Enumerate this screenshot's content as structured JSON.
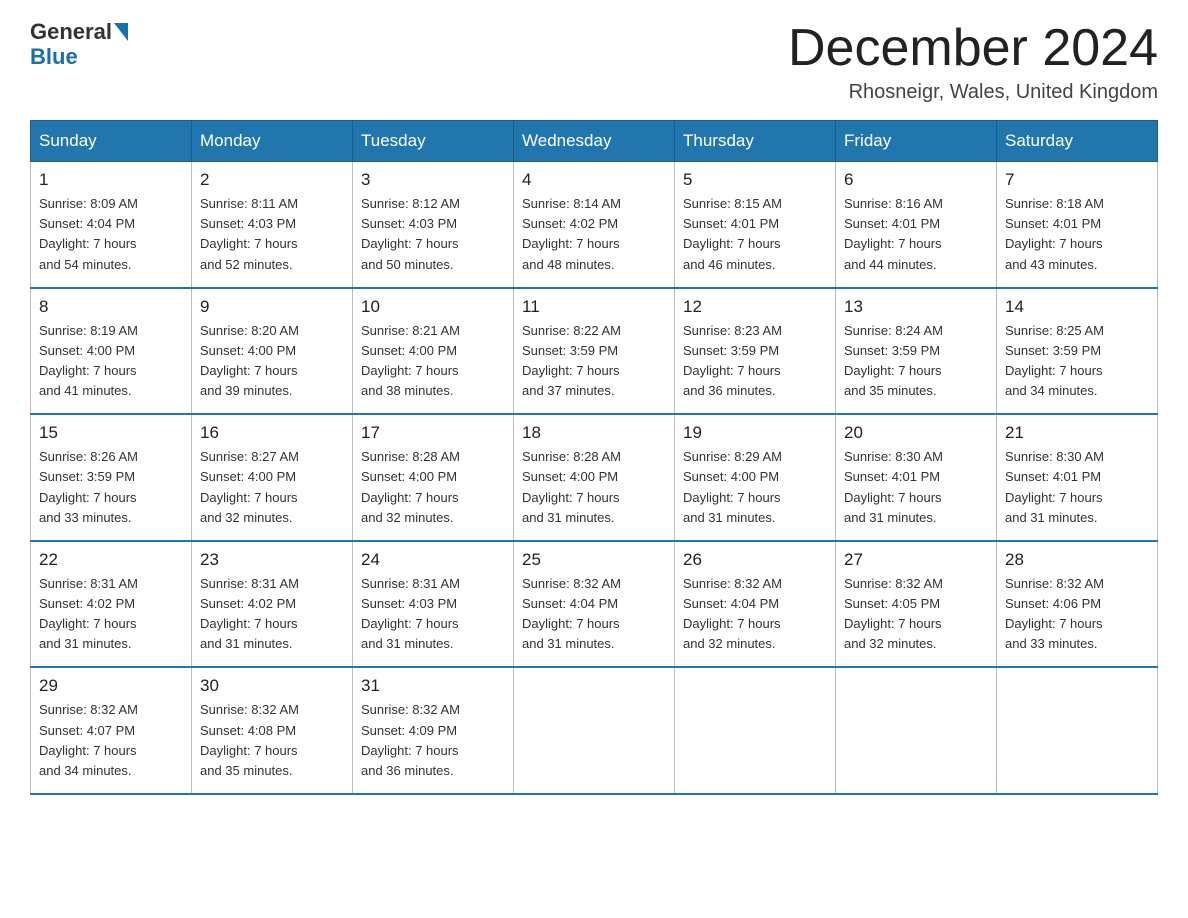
{
  "header": {
    "logo_general": "General",
    "logo_blue": "Blue",
    "month_title": "December 2024",
    "location": "Rhosneigr, Wales, United Kingdom"
  },
  "days_of_week": [
    "Sunday",
    "Monday",
    "Tuesday",
    "Wednesday",
    "Thursday",
    "Friday",
    "Saturday"
  ],
  "weeks": [
    [
      {
        "day": "1",
        "sunrise": "8:09 AM",
        "sunset": "4:04 PM",
        "daylight": "7 hours and 54 minutes."
      },
      {
        "day": "2",
        "sunrise": "8:11 AM",
        "sunset": "4:03 PM",
        "daylight": "7 hours and 52 minutes."
      },
      {
        "day": "3",
        "sunrise": "8:12 AM",
        "sunset": "4:03 PM",
        "daylight": "7 hours and 50 minutes."
      },
      {
        "day": "4",
        "sunrise": "8:14 AM",
        "sunset": "4:02 PM",
        "daylight": "7 hours and 48 minutes."
      },
      {
        "day": "5",
        "sunrise": "8:15 AM",
        "sunset": "4:01 PM",
        "daylight": "7 hours and 46 minutes."
      },
      {
        "day": "6",
        "sunrise": "8:16 AM",
        "sunset": "4:01 PM",
        "daylight": "7 hours and 44 minutes."
      },
      {
        "day": "7",
        "sunrise": "8:18 AM",
        "sunset": "4:01 PM",
        "daylight": "7 hours and 43 minutes."
      }
    ],
    [
      {
        "day": "8",
        "sunrise": "8:19 AM",
        "sunset": "4:00 PM",
        "daylight": "7 hours and 41 minutes."
      },
      {
        "day": "9",
        "sunrise": "8:20 AM",
        "sunset": "4:00 PM",
        "daylight": "7 hours and 39 minutes."
      },
      {
        "day": "10",
        "sunrise": "8:21 AM",
        "sunset": "4:00 PM",
        "daylight": "7 hours and 38 minutes."
      },
      {
        "day": "11",
        "sunrise": "8:22 AM",
        "sunset": "3:59 PM",
        "daylight": "7 hours and 37 minutes."
      },
      {
        "day": "12",
        "sunrise": "8:23 AM",
        "sunset": "3:59 PM",
        "daylight": "7 hours and 36 minutes."
      },
      {
        "day": "13",
        "sunrise": "8:24 AM",
        "sunset": "3:59 PM",
        "daylight": "7 hours and 35 minutes."
      },
      {
        "day": "14",
        "sunrise": "8:25 AM",
        "sunset": "3:59 PM",
        "daylight": "7 hours and 34 minutes."
      }
    ],
    [
      {
        "day": "15",
        "sunrise": "8:26 AM",
        "sunset": "3:59 PM",
        "daylight": "7 hours and 33 minutes."
      },
      {
        "day": "16",
        "sunrise": "8:27 AM",
        "sunset": "4:00 PM",
        "daylight": "7 hours and 32 minutes."
      },
      {
        "day": "17",
        "sunrise": "8:28 AM",
        "sunset": "4:00 PM",
        "daylight": "7 hours and 32 minutes."
      },
      {
        "day": "18",
        "sunrise": "8:28 AM",
        "sunset": "4:00 PM",
        "daylight": "7 hours and 31 minutes."
      },
      {
        "day": "19",
        "sunrise": "8:29 AM",
        "sunset": "4:00 PM",
        "daylight": "7 hours and 31 minutes."
      },
      {
        "day": "20",
        "sunrise": "8:30 AM",
        "sunset": "4:01 PM",
        "daylight": "7 hours and 31 minutes."
      },
      {
        "day": "21",
        "sunrise": "8:30 AM",
        "sunset": "4:01 PM",
        "daylight": "7 hours and 31 minutes."
      }
    ],
    [
      {
        "day": "22",
        "sunrise": "8:31 AM",
        "sunset": "4:02 PM",
        "daylight": "7 hours and 31 minutes."
      },
      {
        "day": "23",
        "sunrise": "8:31 AM",
        "sunset": "4:02 PM",
        "daylight": "7 hours and 31 minutes."
      },
      {
        "day": "24",
        "sunrise": "8:31 AM",
        "sunset": "4:03 PM",
        "daylight": "7 hours and 31 minutes."
      },
      {
        "day": "25",
        "sunrise": "8:32 AM",
        "sunset": "4:04 PM",
        "daylight": "7 hours and 31 minutes."
      },
      {
        "day": "26",
        "sunrise": "8:32 AM",
        "sunset": "4:04 PM",
        "daylight": "7 hours and 32 minutes."
      },
      {
        "day": "27",
        "sunrise": "8:32 AM",
        "sunset": "4:05 PM",
        "daylight": "7 hours and 32 minutes."
      },
      {
        "day": "28",
        "sunrise": "8:32 AM",
        "sunset": "4:06 PM",
        "daylight": "7 hours and 33 minutes."
      }
    ],
    [
      {
        "day": "29",
        "sunrise": "8:32 AM",
        "sunset": "4:07 PM",
        "daylight": "7 hours and 34 minutes."
      },
      {
        "day": "30",
        "sunrise": "8:32 AM",
        "sunset": "4:08 PM",
        "daylight": "7 hours and 35 minutes."
      },
      {
        "day": "31",
        "sunrise": "8:32 AM",
        "sunset": "4:09 PM",
        "daylight": "7 hours and 36 minutes."
      },
      null,
      null,
      null,
      null
    ]
  ]
}
